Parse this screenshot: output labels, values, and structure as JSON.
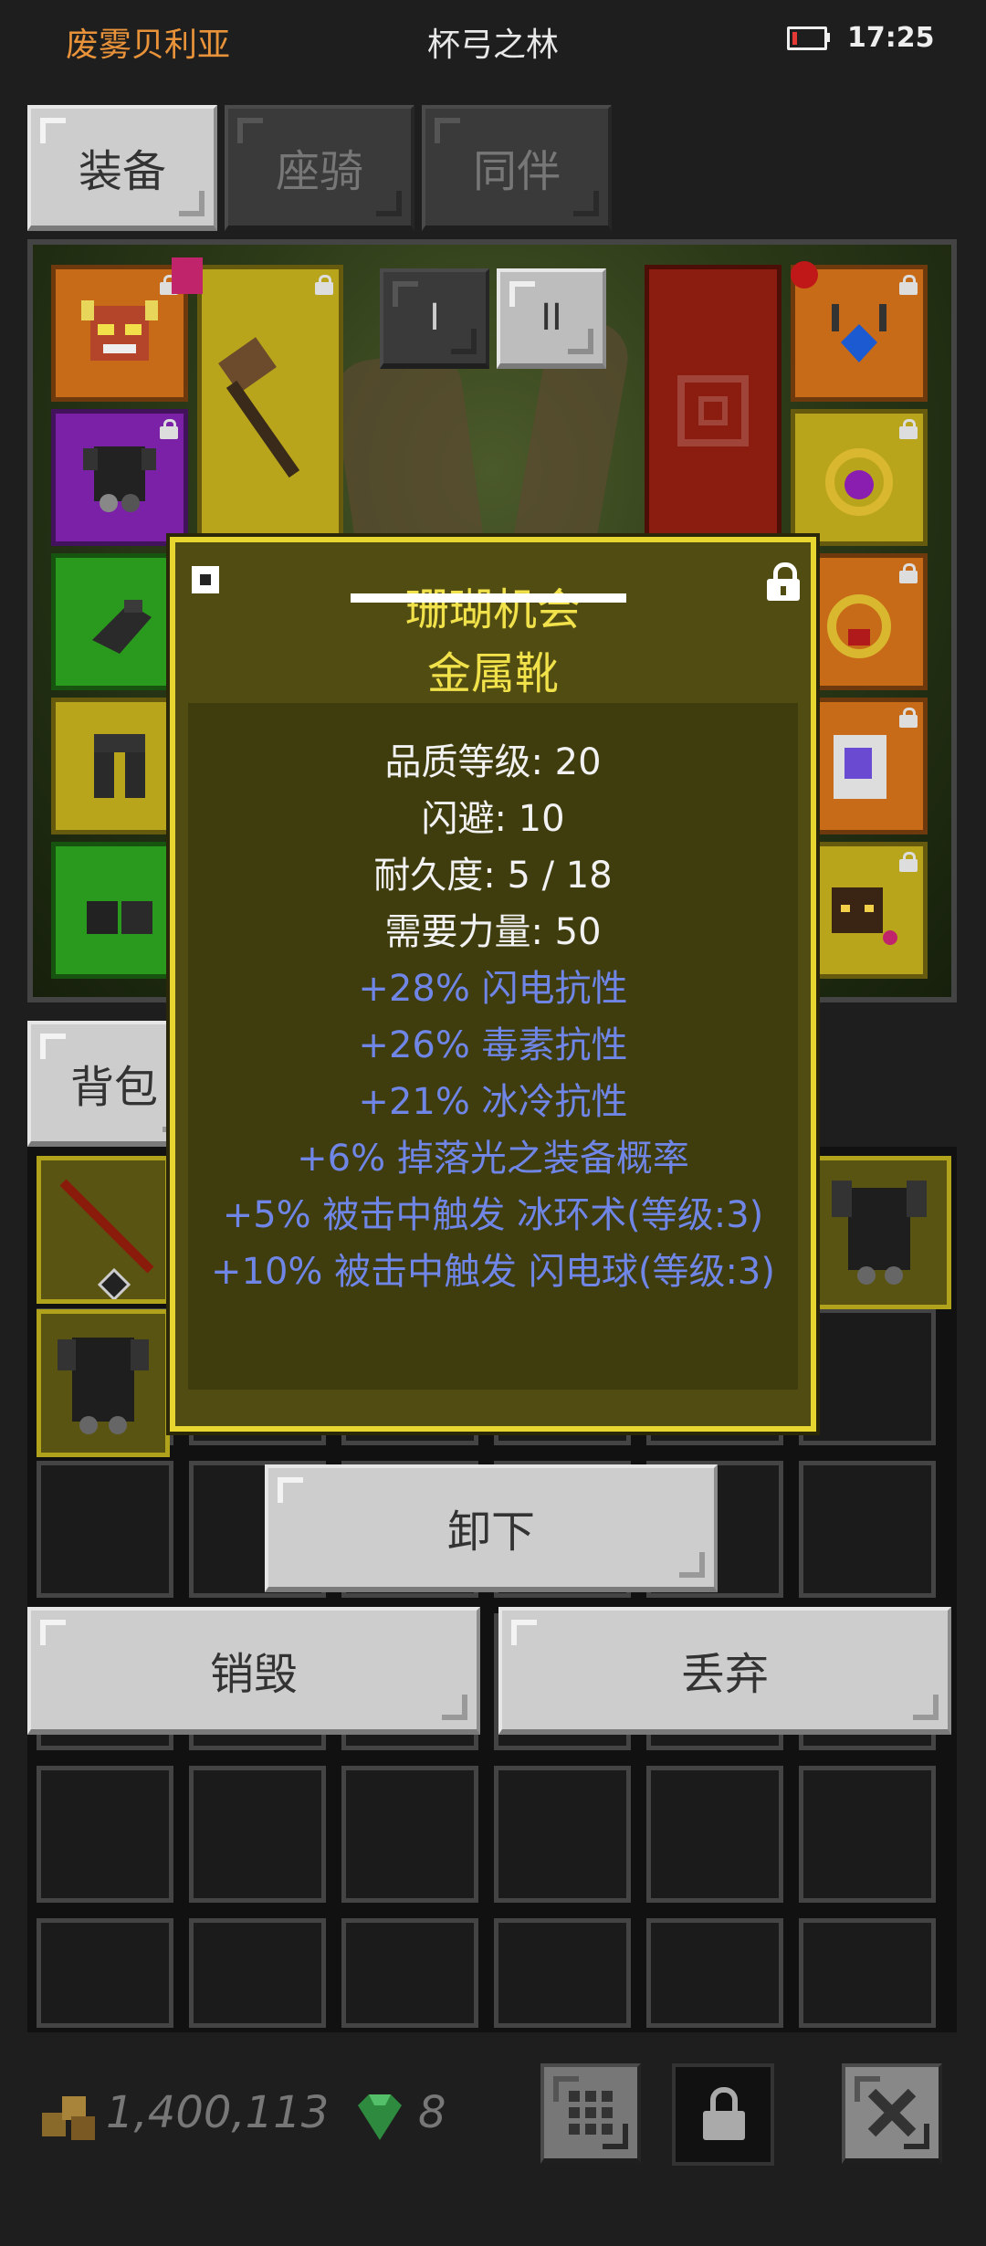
{
  "status_bar": {
    "left_text": "废雾贝利亚",
    "center_text": "杯弓之林",
    "time": "17:25"
  },
  "tabs": [
    {
      "label": "装备",
      "active": true
    },
    {
      "label": "座骑",
      "active": false
    },
    {
      "label": "同伴",
      "active": false
    }
  ],
  "bag_tab": {
    "label": "背包"
  },
  "loadout_buttons": {
    "one": "I",
    "two": "II"
  },
  "tooltip": {
    "name": "珊瑚机会",
    "type": "金属靴",
    "stats": [
      "品质等级: 20",
      "闪避: 10",
      "耐久度: 5 / 18",
      "需要力量: 50"
    ],
    "mods": [
      "+28% 闪电抗性",
      "+26% 毒素抗性",
      "+21% 冰冷抗性",
      "+6% 掉落光之装备概率",
      "+5% 被击中触发 冰环术(等级:3)",
      "+10% 被击中触发 闪电球(等级:3)"
    ]
  },
  "actions": {
    "unequip": "卸下",
    "destroy": "销毁",
    "discard": "丢弃"
  },
  "currency": {
    "gold": "1,400,113",
    "gems": "8"
  },
  "colors": {
    "accent_orange": "#e8923a",
    "tooltip_border": "#e7d630",
    "mod_blue": "#6f86e6"
  }
}
